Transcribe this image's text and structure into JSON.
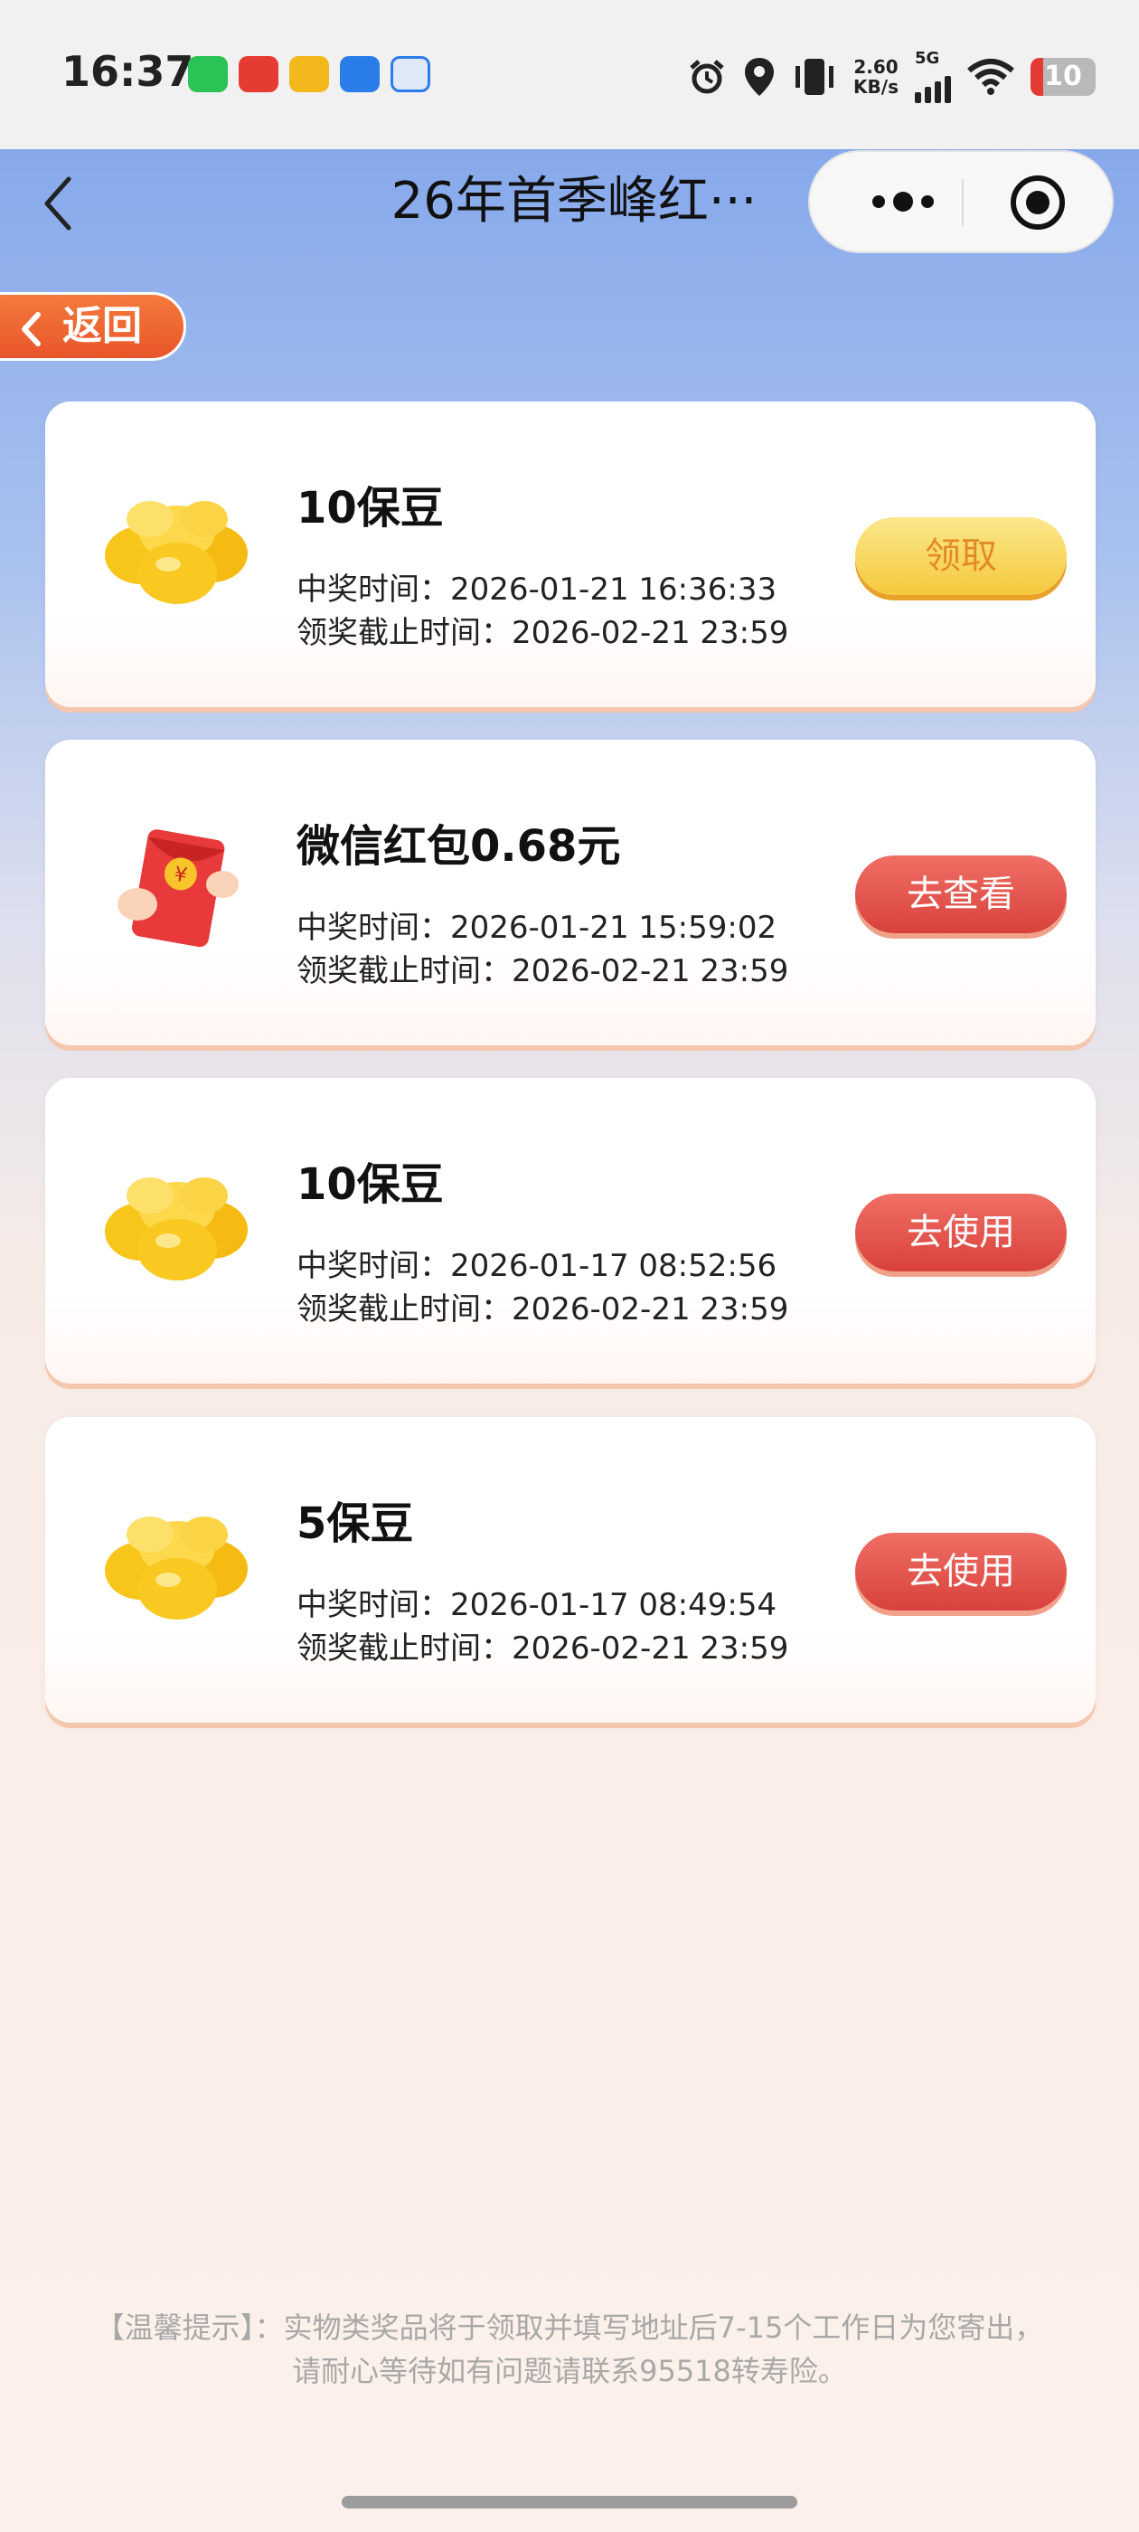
{
  "status_bar": {
    "time": "16:37",
    "net_speed_value": "2.60",
    "net_speed_unit": "KB/s",
    "network": "5G",
    "battery": "10",
    "app_icons": [
      "wechat-icon",
      "app-red-icon",
      "weibo-icon",
      "app-blue-icon",
      "app-message-icon"
    ],
    "icons": [
      "alarm-icon",
      "location-icon",
      "vibrate-icon",
      "signal-icon",
      "wifi-icon",
      "battery-icon"
    ]
  },
  "nav": {
    "title": "26年首季峰红···"
  },
  "back_button": {
    "label": "返回"
  },
  "prizes": [
    {
      "title": "10保豆",
      "win_time": "中奖时间：2026-01-21 16:36:33",
      "deadline": "领奖截止时间：2026-02-21 23:59",
      "button": "领取",
      "image": "gold-beans-icon"
    },
    {
      "title": "微信红包0.68元",
      "win_time": "中奖时间：2026-01-21 15:59:02",
      "deadline": "领奖截止时间：2026-02-21 23:59",
      "button": "去查看",
      "image": "red-envelope-icon"
    },
    {
      "title": "10保豆",
      "win_time": "中奖时间：2026-01-17 08:52:56",
      "deadline": "领奖截止时间：2026-02-21 23:59",
      "button": "去使用",
      "image": "gold-beans-icon"
    },
    {
      "title": "5保豆",
      "win_time": "中奖时间：2026-01-17 08:49:54",
      "deadline": "领奖截止时间：2026-02-21 23:59",
      "button": "去使用",
      "image": "gold-beans-icon"
    }
  ],
  "tip": {
    "line1": "【温馨提示】：实物类奖品将于领取并填写地址后7-15个工作日为您寄出，",
    "line2": "请耐心等待如有问题请联系95518转寿险。"
  },
  "colors": {
    "accent_orange": "#e8552a",
    "button_red": "#d9413c",
    "button_yellow": "#f5c93c"
  }
}
